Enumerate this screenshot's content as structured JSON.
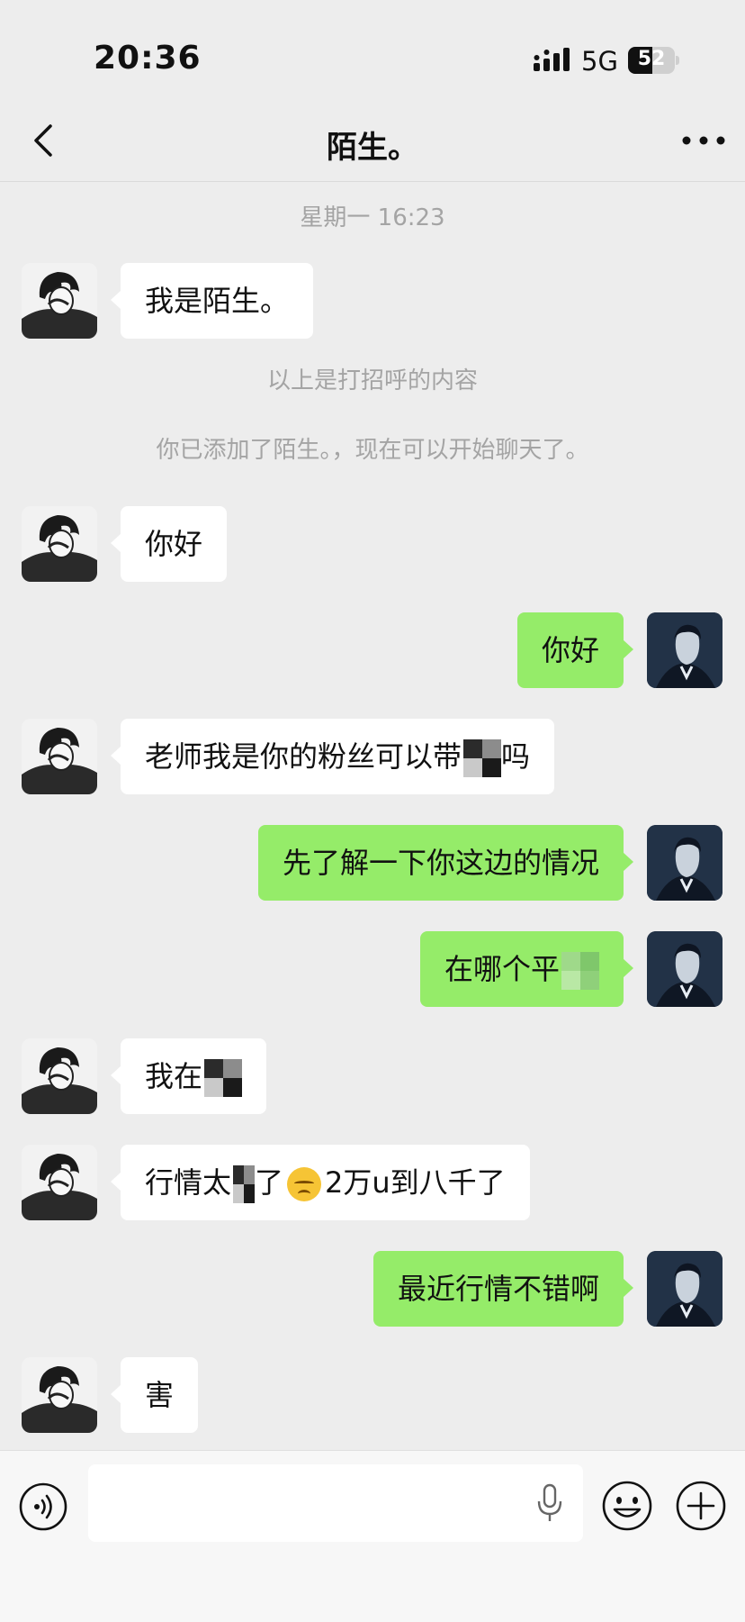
{
  "status_bar": {
    "time": "20:36",
    "network": "5G",
    "battery_level": "52"
  },
  "nav": {
    "title": "陌生。",
    "back_icon": "chevron-left-icon",
    "more_icon": "more-dots-icon"
  },
  "chat": {
    "timestamp": "星期一 16:23",
    "greeting_note": "以上是打招呼的内容",
    "added_note": "你已添加了陌生。，现在可以开始聊天了。",
    "messages": [
      {
        "side": "in",
        "text": "我是陌生。"
      },
      {
        "side": "in",
        "text": "你好"
      },
      {
        "side": "out",
        "text": "你好"
      },
      {
        "side": "in",
        "text": "老师我是你的粉丝可以带",
        "text_after": "吗"
      },
      {
        "side": "out",
        "text": "先了解一下你这边的情况"
      },
      {
        "side": "out",
        "text": "在哪个平"
      },
      {
        "side": "in",
        "text": "我在"
      },
      {
        "side": "in",
        "text": "行情太",
        "text_mid": "了",
        "text_after": "2万u到八千了",
        "emoji": "pensive-face"
      },
      {
        "side": "out",
        "text": "最近行情不错啊"
      },
      {
        "side": "in",
        "text": "害"
      }
    ]
  },
  "input_bar": {
    "placeholder": "",
    "icons": [
      "voice-icon",
      "microphone-icon",
      "emoji-icon",
      "plus-icon"
    ]
  },
  "colors": {
    "background": "#ededed",
    "incoming_bubble": "#ffffff",
    "outgoing_bubble": "#95ec69",
    "system_text": "#a4a4a4"
  }
}
